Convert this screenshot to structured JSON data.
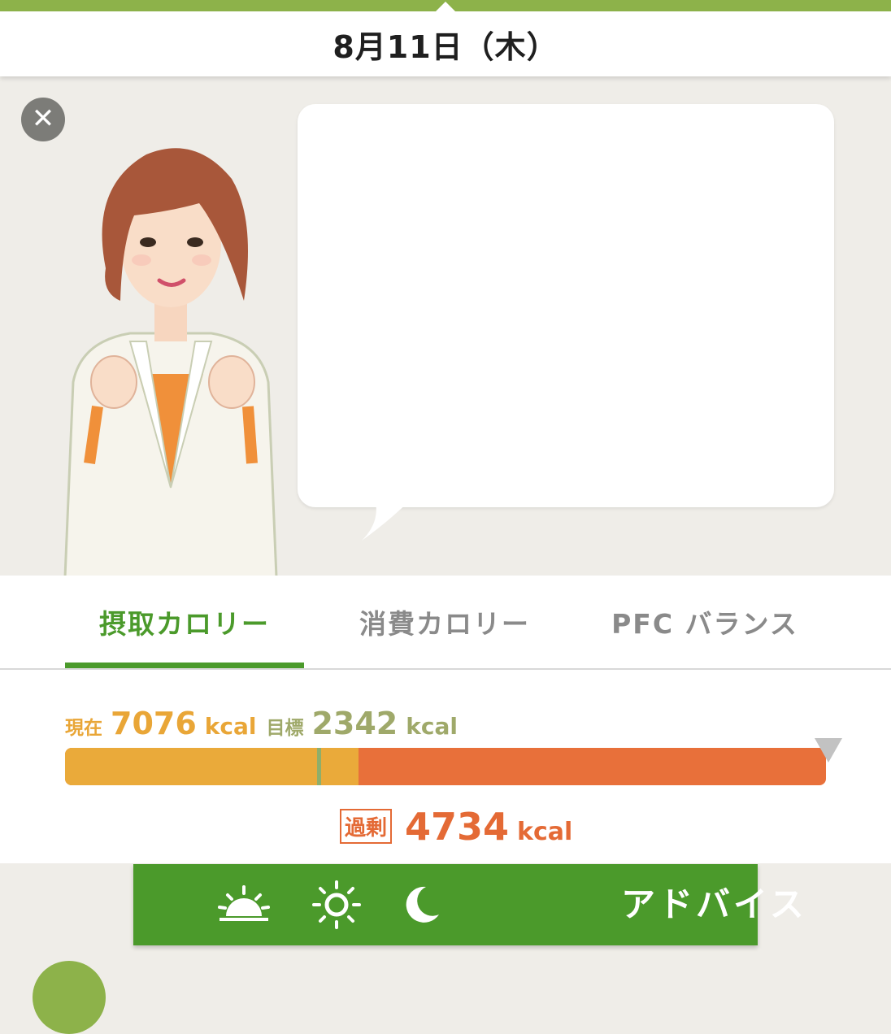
{
  "header": {
    "date": "8月11日（木）"
  },
  "close": {
    "glyph": "✕"
  },
  "tabs": [
    {
      "label": "摂取カロリー",
      "active": true
    },
    {
      "label": "消費カロリー",
      "active": false
    },
    {
      "label": "PFC バランス",
      "active": false
    }
  ],
  "calories": {
    "current_label": "現在",
    "current_value": "7076",
    "current_unit": "kcal",
    "goal_label": "目標",
    "goal_value": "2342",
    "goal_unit": "kcal",
    "excess_label": "過剰",
    "excess_value": "4734",
    "excess_unit": "kcal",
    "current_fraction": 0.386,
    "goal_fraction": 0.331
  },
  "advice": {
    "label": "アドバイス",
    "icons": [
      "sunrise-icon",
      "sun-icon",
      "moon-icon"
    ]
  },
  "colors": {
    "accent_green": "#4b9a2b",
    "top_bar": "#8db24a",
    "current_orange": "#eaaa3a",
    "excess_orange": "#e8703a"
  }
}
